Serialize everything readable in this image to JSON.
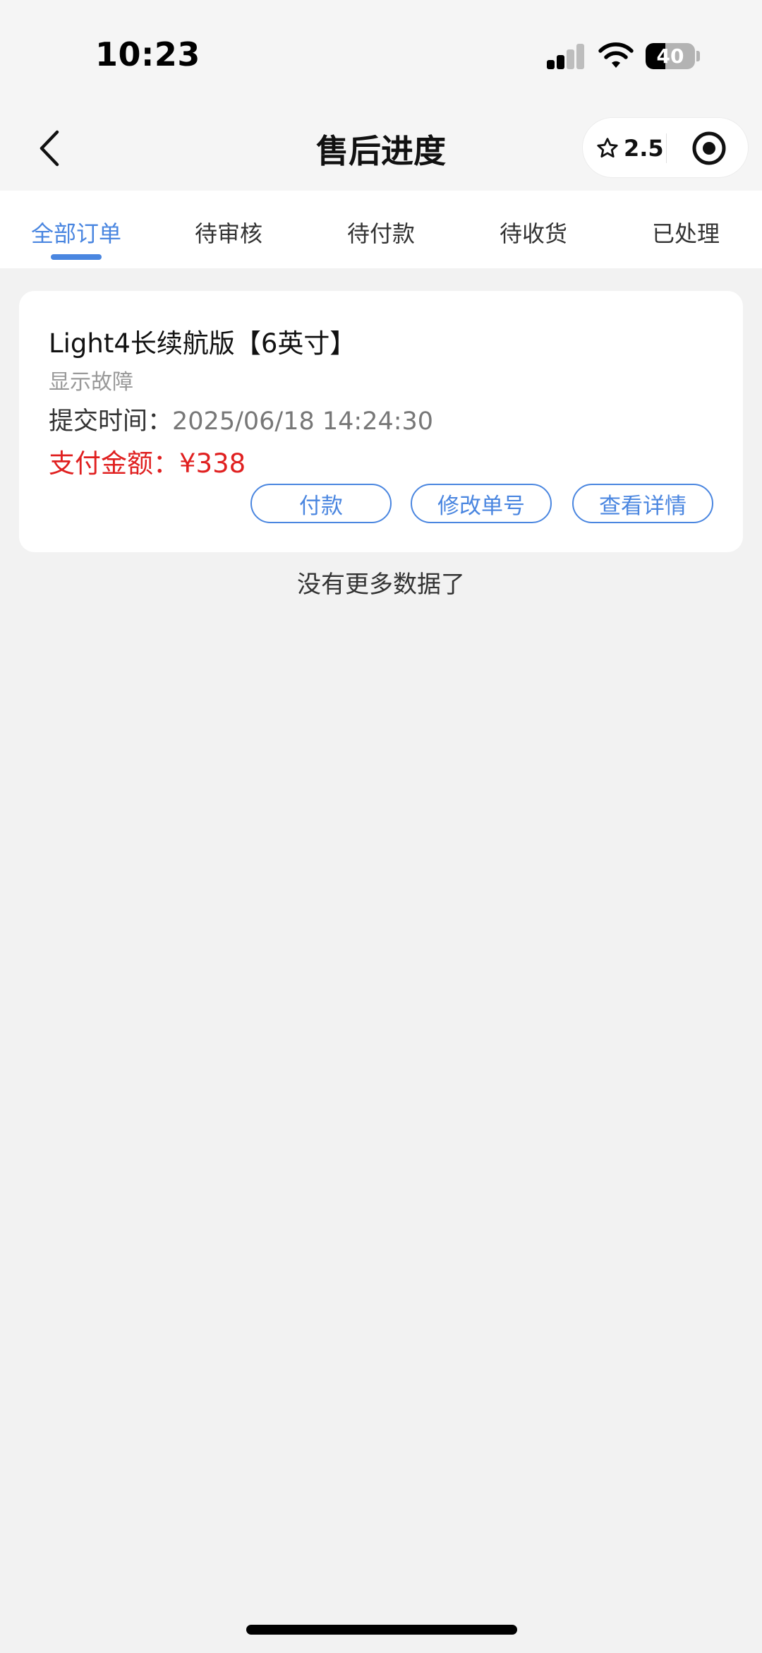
{
  "status_bar": {
    "time": "10:23",
    "battery_level": "40",
    "battery_fraction": 0.4,
    "signal_bars_active": 2,
    "signal_bars_total": 4
  },
  "nav": {
    "back_icon": "chevron-left-icon",
    "title": "售后进度",
    "rating": "2.5",
    "rating_icon": "star-outline-icon",
    "target_icon": "target-icon"
  },
  "tabs": [
    {
      "label": "全部订单",
      "active": true
    },
    {
      "label": "待审核",
      "active": false
    },
    {
      "label": "待付款",
      "active": false
    },
    {
      "label": "待收货",
      "active": false
    },
    {
      "label": "已处理",
      "active": false
    }
  ],
  "order": {
    "product": "Light4长续航版【6英寸】",
    "issue": "显示故障",
    "submit_label": "提交时间：",
    "submit_time": "2025/06/18 14:24:30",
    "amount_label": "支付金额：",
    "amount": "¥338",
    "buttons": {
      "pay": "付款",
      "modify": "修改单号",
      "detail": "查看详情"
    }
  },
  "footer_text": "没有更多数据了",
  "colors": {
    "accent": "#4a86e0",
    "price": "#e02020",
    "background": "#f2f2f2"
  }
}
